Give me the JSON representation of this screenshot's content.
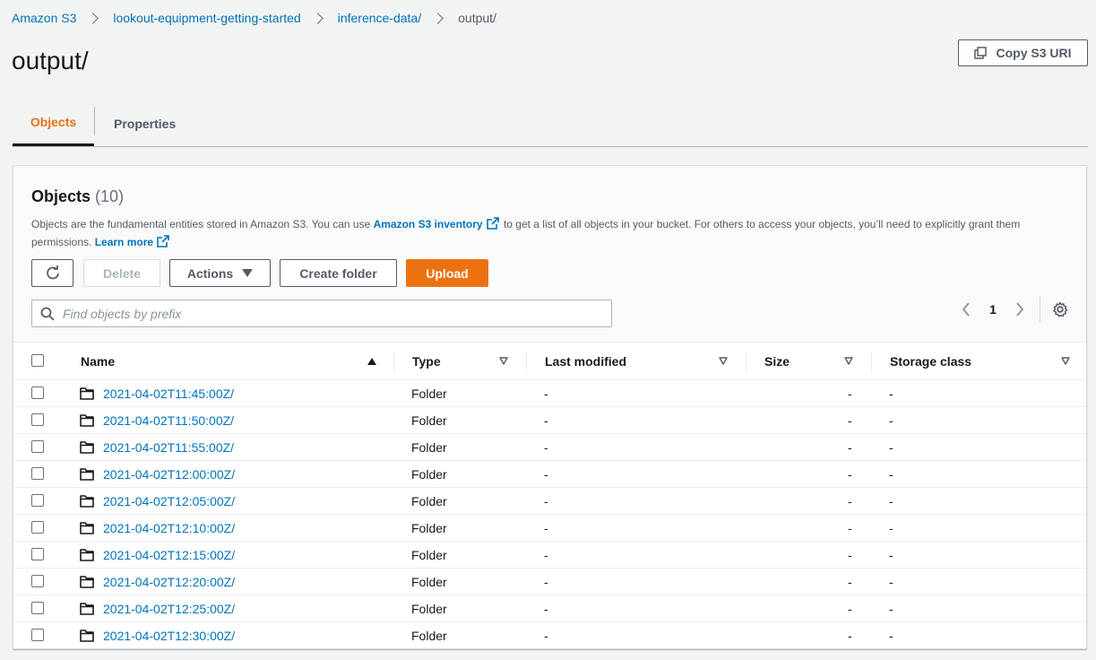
{
  "breadcrumb": {
    "items": [
      "Amazon S3",
      "lookout-equipment-getting-started",
      "inference-data/"
    ],
    "current": "output/"
  },
  "page_title": "output/",
  "copy_uri_label": "Copy S3 URI",
  "tabs": [
    {
      "label": "Objects",
      "active": true
    },
    {
      "label": "Properties",
      "active": false
    }
  ],
  "objects_panel": {
    "title": "Objects",
    "count": "(10)",
    "desc_part1": "Objects are the fundamental entities stored in Amazon S3. You can use ",
    "inventory_link": "Amazon S3 inventory",
    "desc_part2": " to get a list of all objects in your bucket. For others to access your objects, you’ll need to explicitly grant them permissions.",
    "learn_more": "Learn more",
    "buttons": {
      "delete": "Delete",
      "actions": "Actions",
      "create_folder": "Create folder",
      "upload": "Upload"
    },
    "search_placeholder": "Find objects by prefix",
    "page_number": "1"
  },
  "table": {
    "columns": [
      "Name",
      "Type",
      "Last modified",
      "Size",
      "Storage class"
    ],
    "rows": [
      {
        "name": "2021-04-02T11:45:00Z/",
        "type": "Folder",
        "last_modified": "-",
        "size": "-",
        "storage_class": "-"
      },
      {
        "name": "2021-04-02T11:50:00Z/",
        "type": "Folder",
        "last_modified": "-",
        "size": "-",
        "storage_class": "-"
      },
      {
        "name": "2021-04-02T11:55:00Z/",
        "type": "Folder",
        "last_modified": "-",
        "size": "-",
        "storage_class": "-"
      },
      {
        "name": "2021-04-02T12:00:00Z/",
        "type": "Folder",
        "last_modified": "-",
        "size": "-",
        "storage_class": "-"
      },
      {
        "name": "2021-04-02T12:05:00Z/",
        "type": "Folder",
        "last_modified": "-",
        "size": "-",
        "storage_class": "-"
      },
      {
        "name": "2021-04-02T12:10:00Z/",
        "type": "Folder",
        "last_modified": "-",
        "size": "-",
        "storage_class": "-"
      },
      {
        "name": "2021-04-02T12:15:00Z/",
        "type": "Folder",
        "last_modified": "-",
        "size": "-",
        "storage_class": "-"
      },
      {
        "name": "2021-04-02T12:20:00Z/",
        "type": "Folder",
        "last_modified": "-",
        "size": "-",
        "storage_class": "-"
      },
      {
        "name": "2021-04-02T12:25:00Z/",
        "type": "Folder",
        "last_modified": "-",
        "size": "-",
        "storage_class": "-"
      },
      {
        "name": "2021-04-02T12:30:00Z/",
        "type": "Folder",
        "last_modified": "-",
        "size": "-",
        "storage_class": "-"
      }
    ]
  },
  "colors": {
    "link": "#0073bb",
    "accent": "#ec7211",
    "text": "#16191f",
    "background": "#f2f3f3"
  }
}
